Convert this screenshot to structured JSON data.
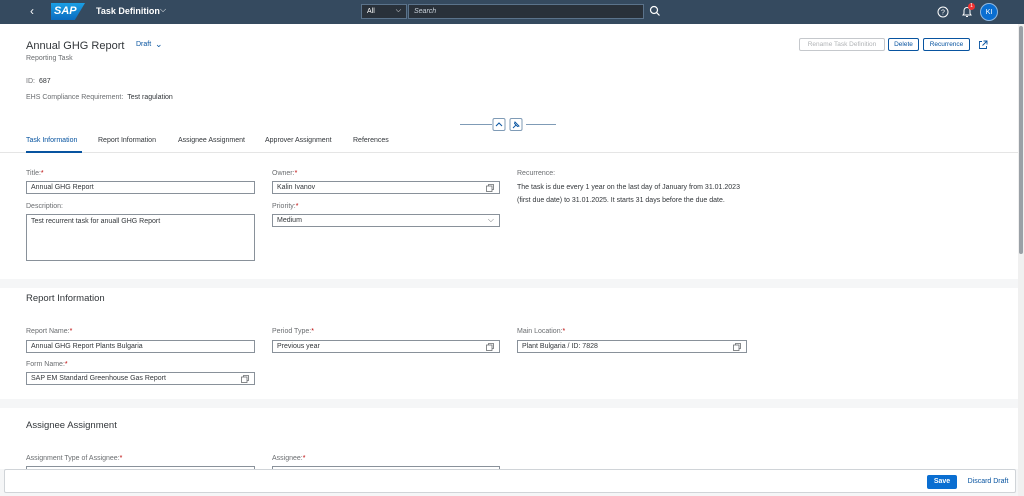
{
  "shell": {
    "app_title": "Task Definition",
    "search_scope": "All",
    "search_placeholder": "Search",
    "notification_count": "1",
    "user_initials": "KI"
  },
  "header": {
    "title": "Annual GHG Report",
    "status": "Draft",
    "subtitle": "Reporting Task",
    "id_label": "ID:",
    "id_value": "687",
    "requirement_label": "EHS Compliance Requirement:",
    "requirement_value": "Test ragulation",
    "buttons": {
      "rename": "Rename Task Definition",
      "delete": "Delete",
      "recurrence": "Recurrence"
    }
  },
  "tabs": [
    "Task Information",
    "Report Information",
    "Assignee Assignment",
    "Approver Assignment",
    "References"
  ],
  "task_info": {
    "title_label": "Title:",
    "title_value": "Annual GHG Report",
    "description_label": "Description:",
    "description_value": "Test recurrent task for anuall GHG Report",
    "owner_label": "Owner:",
    "owner_value": "Kalin Ivanov",
    "priority_label": "Priority:",
    "priority_value": "Medium",
    "recurrence_label": "Recurrence:",
    "recurrence_text": "The task is due every 1 year on the last day of January from 31.01.2023 (first due date) to 31.01.2025. It starts 31 days before the due date."
  },
  "report_info": {
    "section_title": "Report Information",
    "report_name_label": "Report Name:",
    "report_name_value": "Annual GHG Report Plants Bulgaria",
    "period_type_label": "Period Type:",
    "period_type_value": "Previous year",
    "main_location_label": "Main Location:",
    "main_location_value": "Plant Bulgaria / ID: 7828",
    "form_name_label": "Form Name:",
    "form_name_value": "SAP EM Standard Greenhouse Gas Report"
  },
  "assignee": {
    "section_title": "Assignee Assignment",
    "type_label": "Assignment Type of Assignee:",
    "assignee_label": "Assignee:"
  },
  "footer": {
    "save": "Save",
    "discard": "Discard Draft"
  },
  "colors": {
    "shell": "#354a5f",
    "brand_blue": "#0a6ed1",
    "link_blue": "#0854a0",
    "required_red": "#bb0000"
  }
}
